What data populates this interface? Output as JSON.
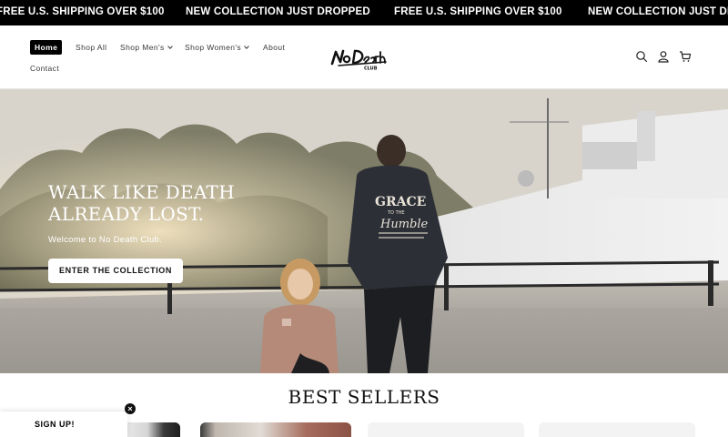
{
  "announcement": {
    "messages": [
      "FREE U.S. SHIPPING OVER $100",
      "NEW COLLECTION JUST DROPPED",
      "FREE U.S. SHIPPING OVER $100",
      "NEW COLLECTION JUST DROPPED"
    ]
  },
  "header": {
    "nav": [
      {
        "label": "Home",
        "active": true
      },
      {
        "label": "Shop All"
      },
      {
        "label": "Shop Men's",
        "has_dropdown": true
      },
      {
        "label": "Shop Women's",
        "has_dropdown": true
      },
      {
        "label": "About"
      },
      {
        "label": "Contact"
      }
    ],
    "logo_text": "NoDeath CLUB",
    "icons": [
      "search-icon",
      "account-icon",
      "cart-icon"
    ]
  },
  "hero": {
    "title_line1": "WALK LIKE DEATH",
    "title_line2": "ALREADY LOST.",
    "subtitle": "Welcome to No Death Club.",
    "button_label": "ENTER THE COLLECTION",
    "hoodie_print": "GRACE\nTO THE\nHumble"
  },
  "best_sellers": {
    "title": "BEST SELLERS"
  },
  "signup": {
    "label": "SIGN UP!",
    "close_glyph": "×"
  }
}
